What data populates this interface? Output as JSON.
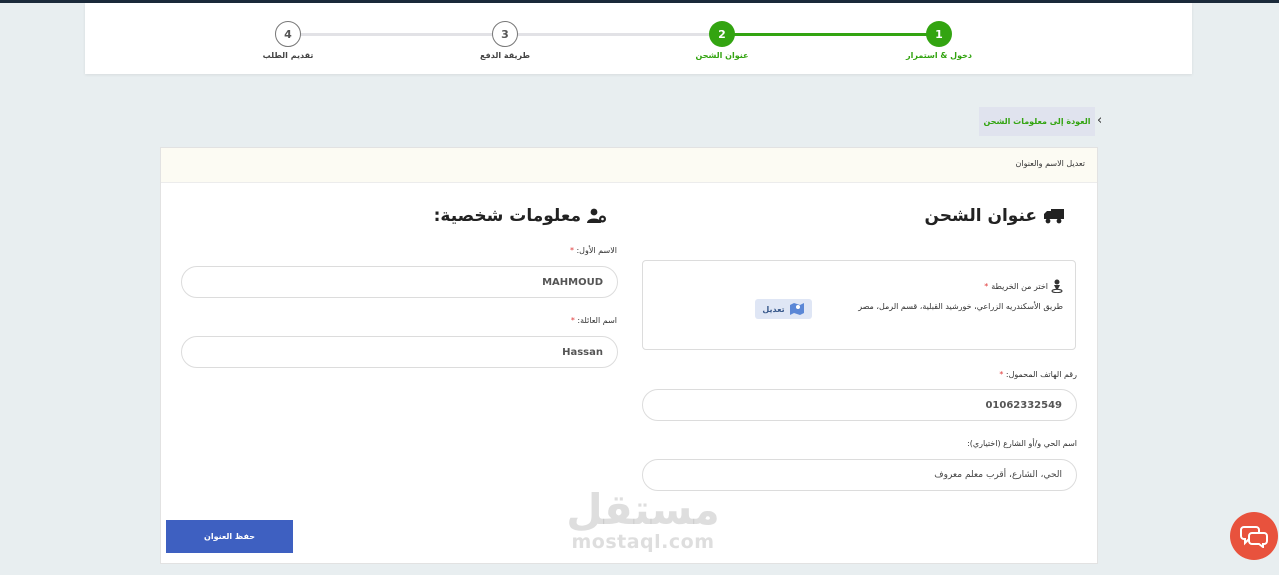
{
  "stepper": {
    "steps": [
      {
        "number": "1",
        "label": "دخول & استمرار",
        "state": "done"
      },
      {
        "number": "2",
        "label": "عنوان الشحن",
        "state": "done"
      },
      {
        "number": "3",
        "label": "طريقة الدفع",
        "state": "todo"
      },
      {
        "number": "4",
        "label": "تقديم الطلب",
        "state": "todo"
      }
    ]
  },
  "back_link": "العودة إلى معلومات الشحن",
  "card": {
    "header": "تعديل الاسم والعنوان",
    "shipping": {
      "title": "عنوان الشحن",
      "map_label": "اختر من الخريطة",
      "required_mark": "*",
      "address": "طريق الأسكندريه الزراعي، خورشيد القبلية، قسم الرمل، مصر",
      "edit_label": "تعديل",
      "phone_label": "رقم الهاتف المحمول:",
      "phone_value": "01062332549",
      "district_label": "اسم الحي و/أو الشارع (اختياري):",
      "district_placeholder": "الحي، الشارع، أقرب معلم معروف"
    },
    "personal": {
      "title": "معلومات شخصية:",
      "first_name_label": "الاسم الأول:",
      "first_name_value": "MAHMOUD",
      "last_name_label": "اسم العائلة:",
      "last_name_value": "Hassan"
    },
    "save_label": "حفظ العنوان"
  },
  "watermark": {
    "arabic": "مستقل",
    "latin": "mostaql.com"
  },
  "colors": {
    "accent_green": "#33a411",
    "primary_blue": "#3e60c1",
    "chat_red": "#e8523d"
  },
  "icons": [
    "truck-icon",
    "user-gear-icon",
    "map-pin-icon",
    "map-icon",
    "chat-icon",
    "chevron-left-icon"
  ]
}
